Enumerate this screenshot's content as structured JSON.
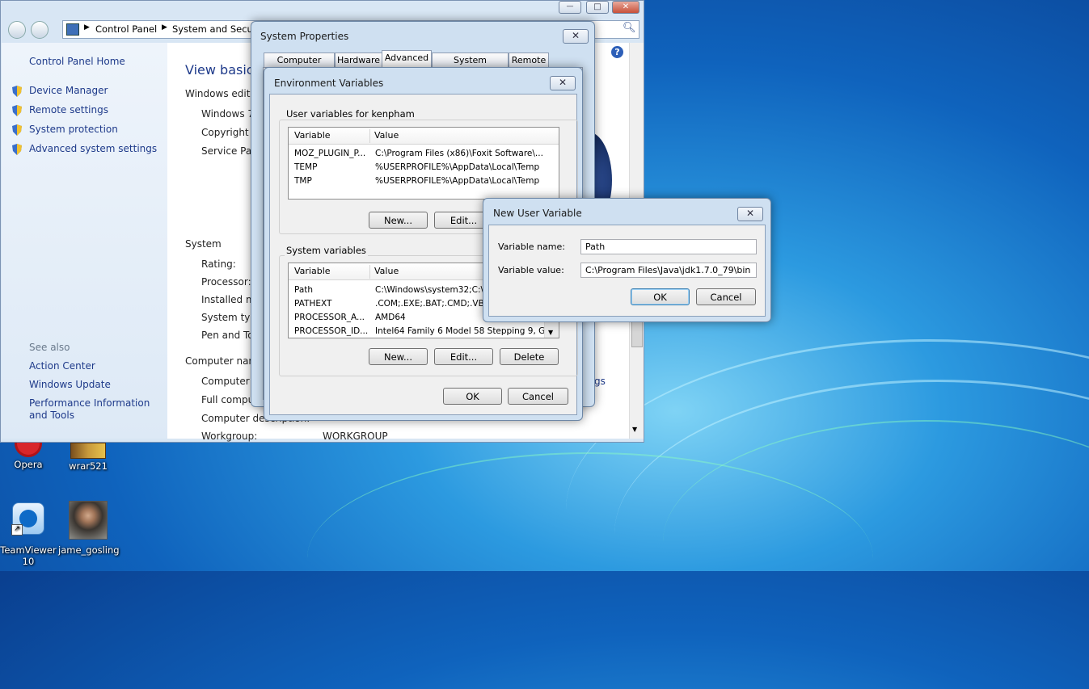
{
  "control_panel": {
    "breadcrumb": [
      "Control Panel",
      "System and Securi"
    ],
    "home_link": "Control Panel Home",
    "tasks": [
      "Device Manager",
      "Remote settings",
      "System protection",
      "Advanced system settings"
    ],
    "see_also_label": "See also",
    "see_also": [
      "Action Center",
      "Windows Update",
      "Performance Information and Tools"
    ],
    "heading": "View basic i",
    "edition_label": "Windows editio",
    "edition_lines": [
      "Windows 7",
      "Copyright ©",
      "Service Pack"
    ],
    "system_label": "System",
    "system_rows": [
      "Rating:",
      "Processor:",
      "Installed me",
      "System type",
      "Pen and To"
    ],
    "computer_label": "Computer nam",
    "computer_rows": [
      "Computer n",
      "Full compu",
      "Computer description:",
      "Workgroup:"
    ],
    "workgroup_value": "WORKGROUP",
    "right_link_fragment": "gs",
    "help_icon": "?"
  },
  "system_properties": {
    "title": "System Properties",
    "tabs": [
      "Computer Name",
      "Hardware",
      "Advanced",
      "System Protection",
      "Remote"
    ],
    "active_tab": "Advanced"
  },
  "env_vars": {
    "title": "Environment Variables",
    "user_group_label": "User variables for kenpham",
    "col_variable": "Variable",
    "col_value": "Value",
    "user_rows": [
      {
        "variable": "MOZ_PLUGIN_P...",
        "value": "C:\\Program Files (x86)\\Foxit Software\\..."
      },
      {
        "variable": "TEMP",
        "value": "%USERPROFILE%\\AppData\\Local\\Temp"
      },
      {
        "variable": "TMP",
        "value": "%USERPROFILE%\\AppData\\Local\\Temp"
      }
    ],
    "user_buttons": {
      "new": "New...",
      "edit": "Edit..."
    },
    "system_group_label": "System variables",
    "system_rows": [
      {
        "variable": "Path",
        "value": "C:\\Windows\\system32;C:\\W"
      },
      {
        "variable": "PATHEXT",
        "value": ".COM;.EXE;.BAT;.CMD;.VBS"
      },
      {
        "variable": "PROCESSOR_A...",
        "value": "AMD64"
      },
      {
        "variable": "PROCESSOR_ID...",
        "value": "Intel64 Family 6 Model 58 Stepping 9, G..."
      }
    ],
    "system_buttons": {
      "new": "New...",
      "edit": "Edit...",
      "delete": "Delete"
    },
    "ok": "OK",
    "cancel": "Cancel"
  },
  "new_user_var": {
    "title": "New User Variable",
    "name_label": "Variable name:",
    "name_value": "Path",
    "value_label": "Variable value:",
    "value_value": "C:\\Program Files\\Java\\jdk1.7.0_79\\bin",
    "ok": "OK",
    "cancel": "Cancel"
  },
  "desktop_icons": [
    {
      "label": "Opera",
      "icon": "opera-icon"
    },
    {
      "label": "wrar521",
      "icon": "winrar-icon"
    },
    {
      "label": "TeamViewer 10",
      "icon": "teamviewer-icon"
    },
    {
      "label": "jame_gosling",
      "icon": "photo-icon"
    }
  ],
  "window_controls": {
    "minimize": "—",
    "maximize": "□",
    "close": "✕",
    "dialog_close": "✕"
  }
}
